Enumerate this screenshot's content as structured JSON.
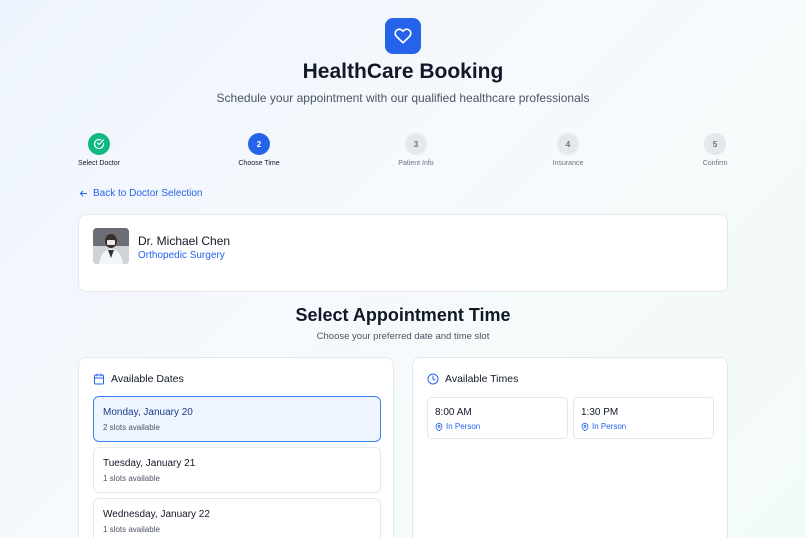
{
  "header": {
    "title": "HealthCare Booking",
    "subtitle": "Schedule your appointment with our qualified healthcare professionals",
    "logo_icon": "heart-icon"
  },
  "steps": [
    {
      "number": "",
      "label": "Select Doctor",
      "state": "done"
    },
    {
      "number": "2",
      "label": "Choose Time",
      "state": "active"
    },
    {
      "number": "3",
      "label": "Patient Info",
      "state": "todo"
    },
    {
      "number": "4",
      "label": "Insurance",
      "state": "todo"
    },
    {
      "number": "5",
      "label": "Confirm",
      "state": "todo"
    }
  ],
  "back_link": "Back to Doctor Selection",
  "doctor": {
    "name": "Dr. Michael Chen",
    "specialty": "Orthopedic Surgery"
  },
  "section": {
    "title": "Select Appointment Time",
    "subtitle": "Choose your preferred date and time slot"
  },
  "dates_panel": {
    "heading": "Available Dates",
    "items": [
      {
        "date": "Monday, January 20",
        "slots": "2 slots available",
        "selected": true
      },
      {
        "date": "Tuesday, January 21",
        "slots": "1 slots available",
        "selected": false
      },
      {
        "date": "Wednesday, January 22",
        "slots": "1 slots available",
        "selected": false
      }
    ]
  },
  "times_panel": {
    "heading": "Available Times",
    "items": [
      {
        "time": "8:00 AM",
        "mode": "In Person"
      },
      {
        "time": "1:30 PM",
        "mode": "In Person"
      }
    ]
  },
  "colors": {
    "primary": "#2563eb",
    "success": "#10b981",
    "selected_bg": "#eff6ff"
  }
}
